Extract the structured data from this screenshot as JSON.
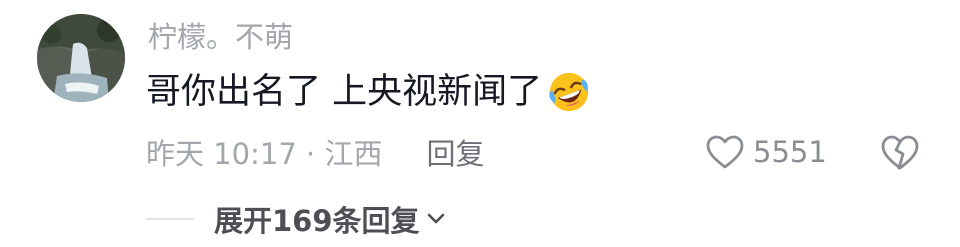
{
  "comment": {
    "username": "柠檬。不萌",
    "text": "哥你出名了 上央视新闻了",
    "emoji_icon": "rofl-laughing-emoji",
    "time_location": "昨天 10:17 · 江西",
    "reply_label": "回复",
    "like_count": "5551",
    "like_icon": "heart-outline-icon",
    "dislike_icon": "broken-heart-icon"
  },
  "replies": {
    "expand_label": "展开169条回复"
  },
  "colors": {
    "text_primary": "#161823",
    "text_secondary": "#a3a6ad",
    "emoji_yellow": "#fcc21b"
  }
}
